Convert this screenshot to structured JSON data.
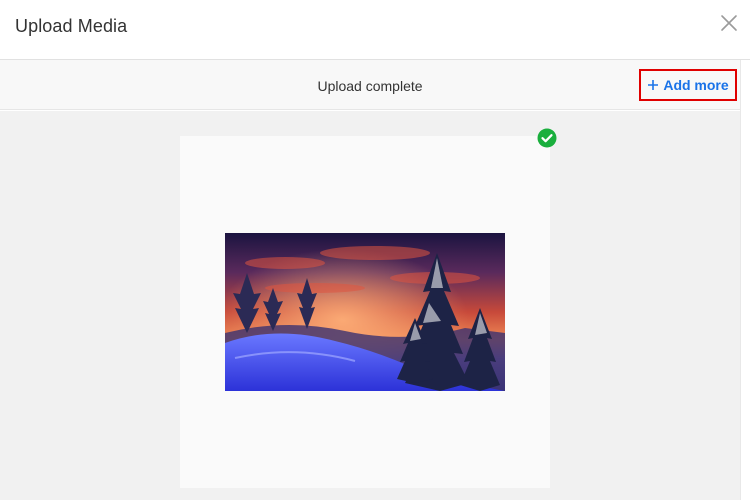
{
  "dialog": {
    "title": "Upload Media",
    "close_icon": "close-icon"
  },
  "toolbar": {
    "status_text": "Upload complete",
    "add_more_label": "Add more",
    "add_more_icon": "plus-icon",
    "add_more_color": "#1a73e8",
    "highlight_color": "#e00000"
  },
  "upload": {
    "file_thumbnail": "winter-landscape-image",
    "status_icon": "check-circle-icon",
    "status_color": "#1aaf3d"
  }
}
